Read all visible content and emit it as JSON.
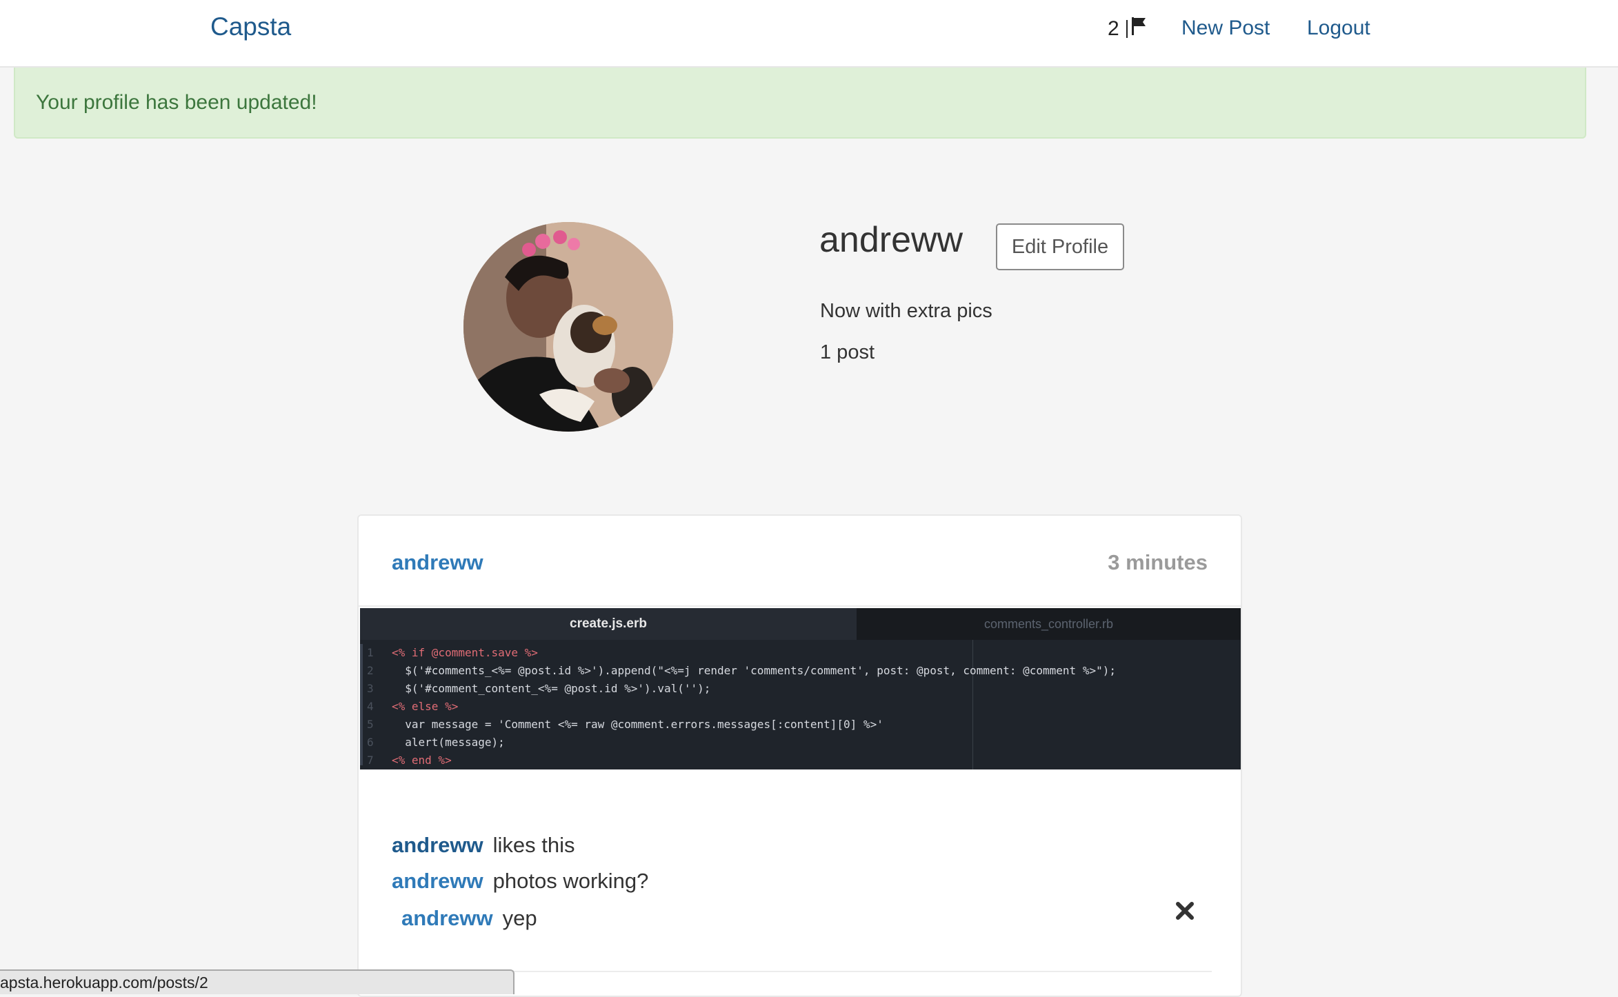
{
  "navbar": {
    "brand": "Capsta",
    "notification_count": "2",
    "new_post_label": "New Post",
    "logout_label": "Logout"
  },
  "alert": {
    "message": "Your profile has been updated!"
  },
  "profile": {
    "username": "andreww",
    "edit_button_label": "Edit Profile",
    "bio": "Now with extra pics",
    "post_count": "1 post"
  },
  "post": {
    "author": "andreww",
    "time_ago": "3 minutes",
    "image": {
      "active_tab": "create.js.erb",
      "inactive_tab": "comments_controller.rb",
      "code_lines": [
        "<% if @comment.save %>",
        "  $('#comments_<%= @post.id %>').append(\"<%=j render 'comments/comment', post: @post, comment: @comment %>\");",
        "  $('#comment_content_<%= @post.id %>').val('');",
        "<% else %>",
        "  var message = 'Comment <%= raw @comment.errors.messages[:content][0] %>'",
        "  alert(message);",
        "<% end %>"
      ]
    },
    "likes": {
      "user": "andreww",
      "text": "likes this"
    },
    "comments": [
      {
        "user": "andreww",
        "text": "photos working?"
      },
      {
        "user": "andreww",
        "text": "yep"
      }
    ]
  },
  "status_bar": {
    "url": "apsta.herokuapp.com/posts/2"
  },
  "colors": {
    "brand": "#1f5a8c",
    "link": "#2f7ab8",
    "alert_bg": "#dff0d8",
    "alert_text": "#3c763d",
    "page_bg": "#f5f5f5"
  }
}
